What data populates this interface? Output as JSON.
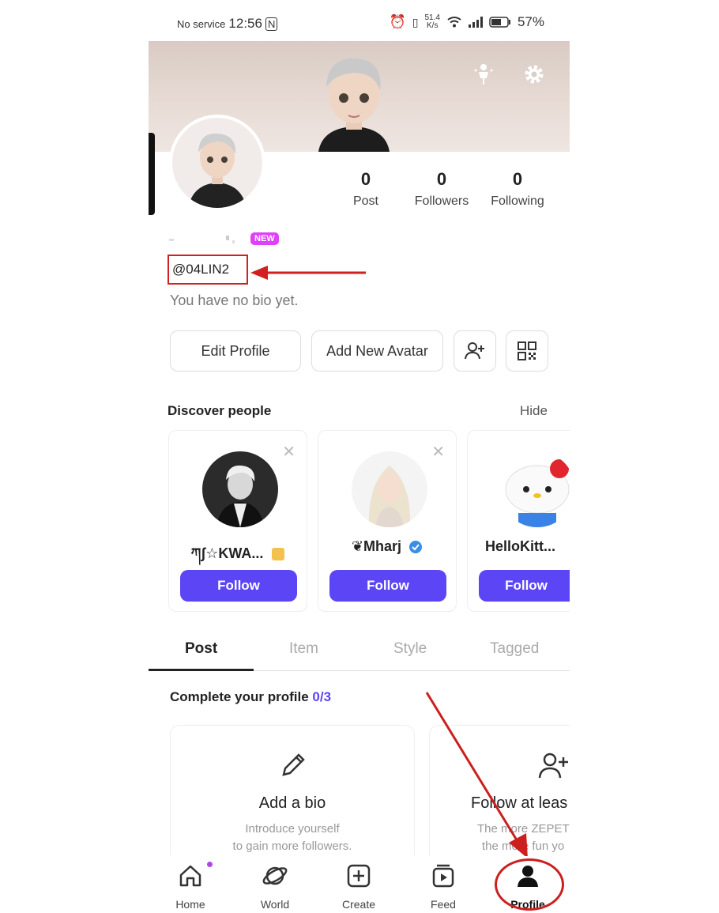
{
  "status_bar": {
    "carrier": "No service",
    "time": "12:56",
    "speed_value": "51.4",
    "speed_unit": "K/s",
    "battery": "57%"
  },
  "stats": [
    {
      "value": "0",
      "label": "Post"
    },
    {
      "value": "0",
      "label": "Followers"
    },
    {
      "value": "0",
      "label": "Following"
    }
  ],
  "profile": {
    "badge": "NEW",
    "handle": "@04LIN2",
    "bio": "You have no bio yet."
  },
  "actions": {
    "edit_profile": "Edit Profile",
    "add_avatar": "Add New Avatar"
  },
  "discover": {
    "title": "Discover people",
    "hide_label": "Hide",
    "people": [
      {
        "name": "ཀʃ☆KWA...",
        "follow_label": "Follow"
      },
      {
        "name": "❦Mharj",
        "follow_label": "Follow"
      },
      {
        "name": "HelloKitt...",
        "follow_label": "Follow"
      }
    ]
  },
  "tabs": [
    "Post",
    "Item",
    "Style",
    "Tagged"
  ],
  "complete": {
    "title": "Complete your profile",
    "count": "0/3",
    "tasks": [
      {
        "title": "Add a bio",
        "desc_line1": "Introduce yourself",
        "desc_line2": "to gain more followers."
      },
      {
        "title": "Follow at leas",
        "desc_line1": "The more ZEPET",
        "desc_line2": "the more fun yo"
      }
    ]
  },
  "nav": [
    {
      "label": "Home",
      "icon": "home-icon"
    },
    {
      "label": "World",
      "icon": "planet-icon"
    },
    {
      "label": "Create",
      "icon": "plus-square-icon"
    },
    {
      "label": "Feed",
      "icon": "play-stack-icon"
    },
    {
      "label": "Profile",
      "icon": "user-icon"
    }
  ],
  "colors": {
    "accent": "#5b45f5",
    "badge": "#e040fb",
    "annotation": "#d21f1f"
  }
}
